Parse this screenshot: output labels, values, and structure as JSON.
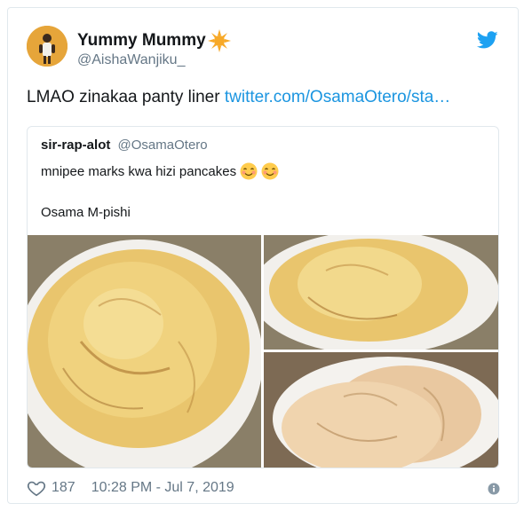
{
  "tweet": {
    "author_name": "Yummy Mummy",
    "author_handle": "@AishaWanjiku_",
    "text": "LMAO zinakaa panty liner ",
    "link_text": "twitter.com/OsamaOtero/sta…",
    "like_count": "187",
    "timestamp": "10:28 PM - Jul 7, 2019"
  },
  "quoted": {
    "author_name": "sir-rap-alot",
    "author_handle": "@OsamaOtero",
    "line1": "mnipee marks kwa hizi pancakes",
    "line2": "Osama M-pishi"
  },
  "icons": {
    "name_badge": "sun-emoji-icon",
    "brand": "twitter-bird-icon",
    "like": "heart-icon",
    "info": "info-icon",
    "emoji": "smiling-face-emoji-icon"
  },
  "colors": {
    "link": "#1b95e0",
    "secondary_text": "#657786",
    "border": "#e1e8ed",
    "twitter_blue": "#1da1f2"
  }
}
